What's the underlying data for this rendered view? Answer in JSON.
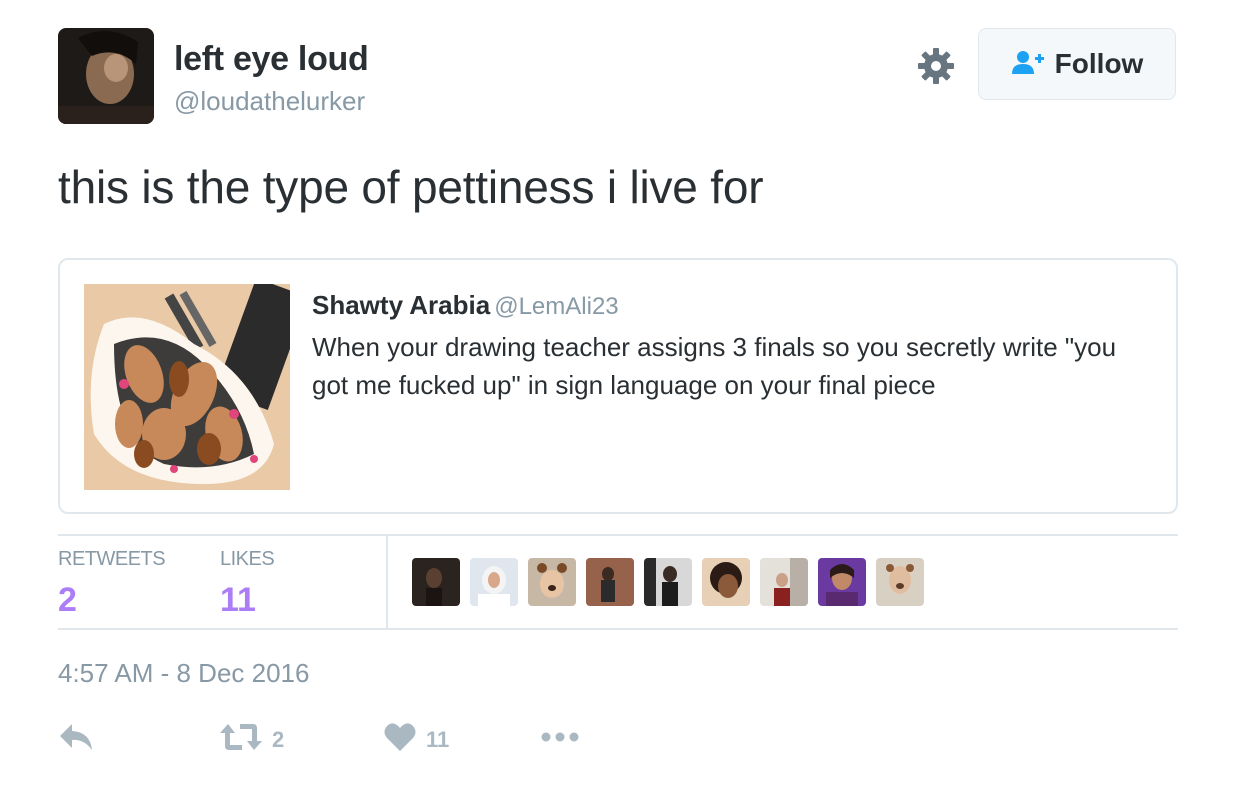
{
  "author": {
    "name": "left eye loud",
    "handle": "@loudathelurker",
    "avatar": "avatar-icon"
  },
  "header": {
    "settings_icon": "gear-icon",
    "follow_label": "Follow",
    "follow_icon": "add-user-icon"
  },
  "tweet": {
    "text": "this is the type of pettiness i live for"
  },
  "quoted": {
    "name": "Shawty Arabia",
    "handle": "@LemAli23",
    "text": "When your drawing teacher assigns 3 finals so you secretly write \"you got me fucked up\" in sign language on your final piece",
    "image": "artwork-thumbnail"
  },
  "stats": {
    "retweets_label": "RETWEETS",
    "retweets_count": "2",
    "likes_label": "LIKES",
    "likes_count": "11"
  },
  "likers": [
    "liker-avatar-1",
    "liker-avatar-2",
    "liker-avatar-3",
    "liker-avatar-4",
    "liker-avatar-5",
    "liker-avatar-6",
    "liker-avatar-7",
    "liker-avatar-8",
    "liker-avatar-9"
  ],
  "timestamp": "4:57 AM - 8 Dec 2016",
  "actions": {
    "reply_icon": "reply-icon",
    "retweet_icon": "retweet-icon",
    "retweet_count": "2",
    "like_icon": "heart-icon",
    "like_count": "11",
    "more_icon": "more-icon"
  },
  "colors": {
    "accent": "#ab7df6",
    "muted": "#8899a6",
    "text": "#292f33",
    "border": "#e1e8ed",
    "action": "#aab8c2"
  }
}
